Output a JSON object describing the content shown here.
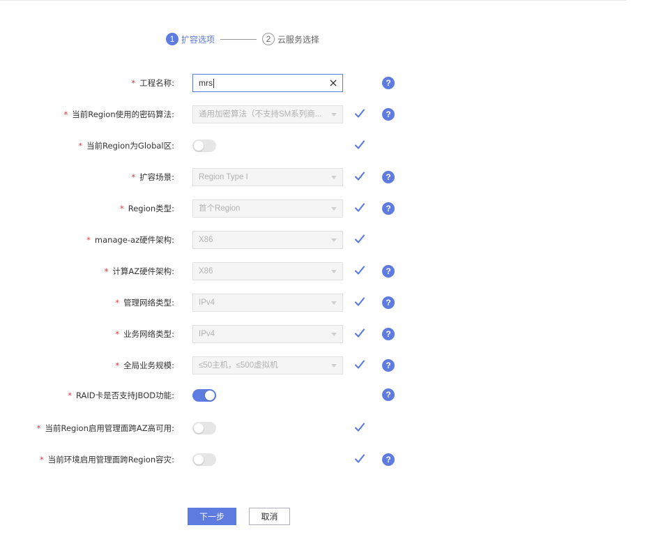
{
  "stepper": {
    "steps": [
      {
        "num": "1",
        "label": "扩容选项",
        "active": true
      },
      {
        "num": "2",
        "label": "云服务选择",
        "active": false
      }
    ]
  },
  "form": {
    "project_name": {
      "label": "工程名称:",
      "value": "mrs"
    },
    "crypto_algorithm": {
      "label": "当前Region使用的密码算法:",
      "value": "通用加密算法（不支持SM系列商..."
    },
    "is_global": {
      "label": "当前Region为Global区:",
      "state": "off"
    },
    "expansion_scenario": {
      "label": "扩容场景:",
      "value": "Region Type I"
    },
    "region_type": {
      "label": "Region类型:",
      "value": "首个Region"
    },
    "manage_az_arch": {
      "label": "manage-az硬件架构:",
      "value": "X86"
    },
    "compute_az_arch": {
      "label": "计算AZ硬件架构:",
      "value": "X86"
    },
    "mgmt_network_type": {
      "label": "管理网络类型:",
      "value": "IPv4"
    },
    "service_network_type": {
      "label": "业务网络类型:",
      "value": "IPv4"
    },
    "global_service_scale": {
      "label": "全局业务规模:",
      "value": "≤50主机，≤500虚拟机"
    },
    "raid_jbod": {
      "label": "RAID卡是否支持JBOD功能:",
      "state": "on"
    },
    "mgmt_cross_az_ha": {
      "label": "当前Region启用管理面跨AZ高可用:",
      "state": "off"
    },
    "mgmt_cross_region_dr": {
      "label": "当前环境启用管理面跨Region容灾:",
      "state": "off"
    }
  },
  "required_mark": "*",
  "help_glyph": "?",
  "buttons": {
    "next": "下一步",
    "cancel": "取消"
  },
  "colors": {
    "accent": "#5e7ce0",
    "required": "#e0393e"
  }
}
